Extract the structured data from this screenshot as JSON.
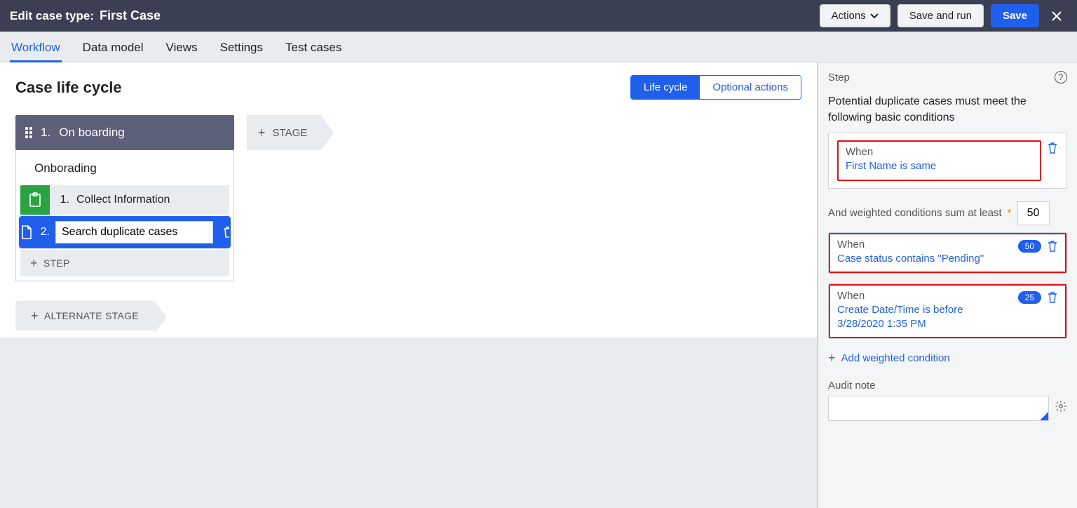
{
  "header": {
    "edit_label": "Edit case type:",
    "case_name": "First Case",
    "actions_label": "Actions",
    "save_run_label": "Save and run",
    "save_label": "Save"
  },
  "tabs": {
    "workflow": "Workflow",
    "data_model": "Data model",
    "views": "Views",
    "settings": "Settings",
    "test_cases": "Test cases"
  },
  "canvas": {
    "title": "Case life cycle",
    "seg_life": "Life cycle",
    "seg_optional": "Optional actions",
    "stage_num": "1.",
    "stage_name": "On boarding",
    "process_name": "Onborading",
    "step1_num": "1.",
    "step1_name": "Collect Information",
    "step2_num": "2.",
    "step2_value": "Search duplicate cases",
    "add_step": "STEP",
    "add_stage": "STAGE",
    "alt_stage": "ALTERNATE STAGE"
  },
  "side": {
    "panel_label": "Step",
    "intro": "Potential duplicate cases must meet the following basic conditions",
    "basic": {
      "when": "When",
      "text": "First Name is same"
    },
    "weighted_label": "And weighted conditions sum at least",
    "weighted_value": "50",
    "w1": {
      "when": "When",
      "text": "Case status contains \"Pending\"",
      "weight": "50"
    },
    "w2": {
      "when": "When",
      "text": "Create Date/Time is before 3/28/2020 1:35 PM",
      "weight": "25"
    },
    "add_weighted": "Add weighted condition",
    "audit_label": "Audit note"
  }
}
